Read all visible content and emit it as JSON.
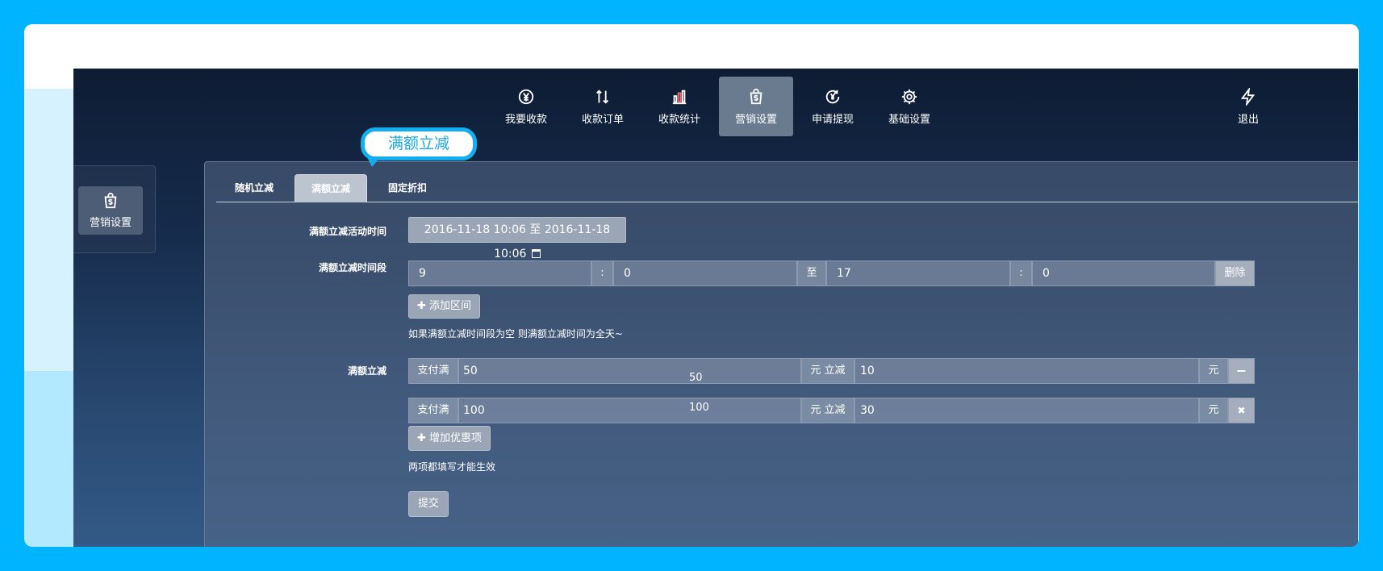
{
  "nav": {
    "items": [
      {
        "label": "我要收款",
        "icon": "yen-circle-icon"
      },
      {
        "label": "收款订单",
        "icon": "sort-arrows-icon"
      },
      {
        "label": "收款统计",
        "icon": "bar-chart-icon"
      },
      {
        "label": "营销设置",
        "icon": "shopping-bag-dollar-icon",
        "active": true
      },
      {
        "label": "申请提现",
        "icon": "yen-refresh-icon"
      },
      {
        "label": "基础设置",
        "icon": "gear-icon"
      }
    ],
    "logout": "退出"
  },
  "side": {
    "label": "营销设置"
  },
  "tabs": [
    "随机立减",
    "满额立减",
    "固定折扣"
  ],
  "active_tab": 1,
  "tooltip": "满额立减",
  "form": {
    "time_label": "满额立减活动时间",
    "time_value": "2016-11-18 10:06 至 2016-11-18 10:06",
    "period_label": "满额立减时间段",
    "period": {
      "h1": "9",
      "colon": ":",
      "m1": "0",
      "to": "至",
      "h2": "17",
      "m2": "0",
      "delete": "删除"
    },
    "add_range": "添加区间",
    "period_note": "如果满额立减时间段为空 则满额立减时间为全天~",
    "discount_label": "满额立减",
    "rules": [
      {
        "pay_prefix": "支付满",
        "pay": "50",
        "mid": "元 立减",
        "minus": "10",
        "unit": "元",
        "ghost": "50",
        "action": "−"
      },
      {
        "pay_prefix": "支付满",
        "pay": "100",
        "mid": "元 立减",
        "minus": "30",
        "unit": "元",
        "ghost": "100",
        "action": "✖"
      }
    ],
    "add_rule": "增加优惠项",
    "rule_note": "两项都填写才能生效",
    "submit": "提交"
  }
}
